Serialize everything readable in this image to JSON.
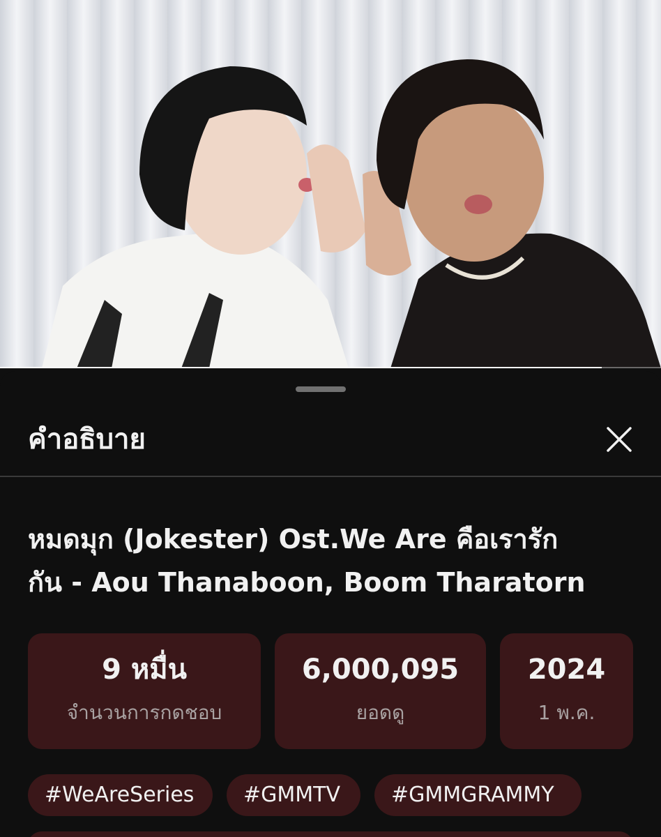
{
  "video": {
    "progress": 0.91
  },
  "description_sheet": {
    "header_title": "คำอธิบาย",
    "close_icon": "close-icon",
    "video_title_line1": "หมดมุก (Jokester) Ost.We Are คือเรารัก",
    "video_title_line2": "กัน - Aou Thanaboon, Boom Tharatorn",
    "stats": [
      {
        "value": "9 หมื่น",
        "label": "จำนวนการกดชอบ"
      },
      {
        "value": "6,000,095",
        "label": "ยอดดู"
      },
      {
        "value": "2024",
        "label": "1 พ.ค."
      }
    ],
    "hashtags": [
      "#WeAreSeries",
      "#GMMTV",
      "#GMMGRAMMY"
    ]
  },
  "colors": {
    "background": "#0f0f0f",
    "card": "#3a1719",
    "text_primary": "#f1f1f1",
    "text_secondary": "#a9a2a2"
  }
}
